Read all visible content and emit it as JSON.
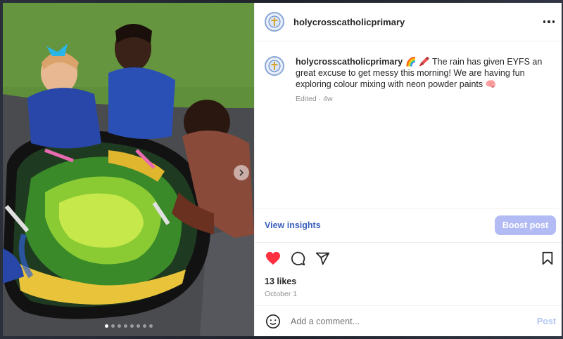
{
  "post": {
    "username": "holycrosscatholicprimary",
    "caption_user": "holycrosscatholicprimary",
    "caption_text": "🌈 🖍️ The rain has given EYFS an great excuse to get messy this morning! We are having fun exploring colour mixing with neon powder paints 🧠",
    "meta": "Edited · 4w",
    "likes": "13 likes",
    "date": "October 1"
  },
  "insights": {
    "view_label": "View insights",
    "boost_label": "Boost post"
  },
  "comment": {
    "placeholder": "Add a comment...",
    "post_label": "Post"
  },
  "carousel": {
    "total_slides": 8,
    "current_slide": 1
  },
  "icons": {
    "like": "heart-icon",
    "comment": "comment-icon",
    "share": "share-icon",
    "save": "bookmark-icon",
    "emoji": "emoji-icon",
    "more": "more-icon",
    "next": "chevron-right-icon"
  },
  "colors": {
    "like": "#ff3040",
    "link": "#3b5fc0",
    "boost": "#b3bbf5",
    "post": "#b3c6f0"
  }
}
